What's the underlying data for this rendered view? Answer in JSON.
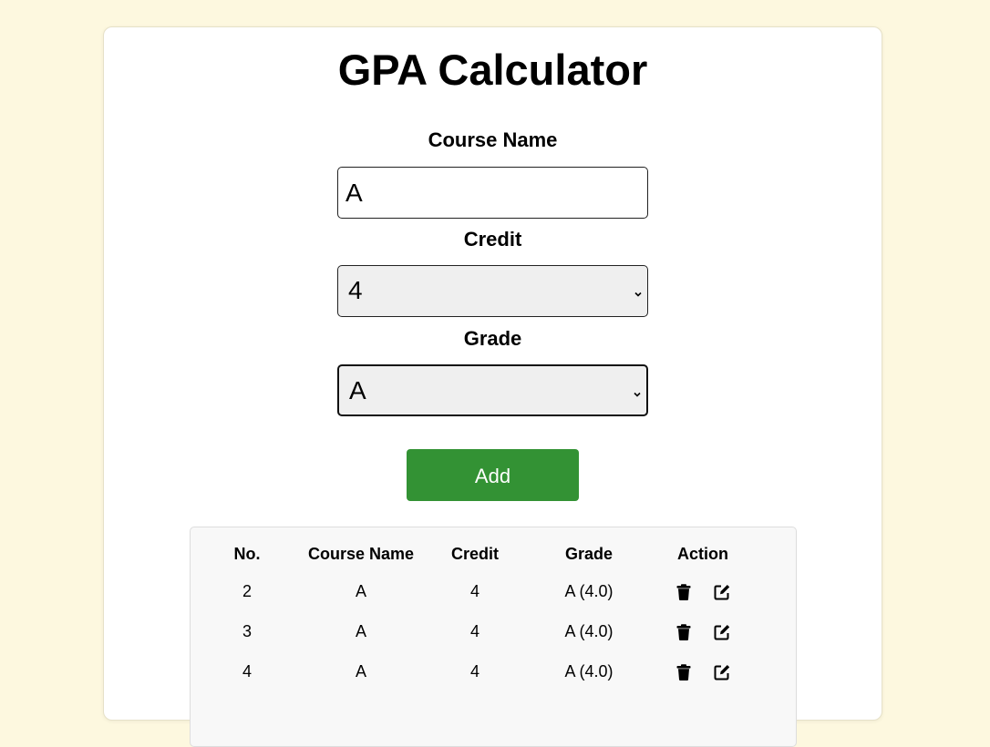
{
  "header": {
    "title": "GPA Calculator"
  },
  "form": {
    "course_name_label": "Course Name",
    "course_name_value": "A",
    "credit_label": "Credit",
    "credit_value": "4",
    "grade_label": "Grade",
    "grade_value": "A",
    "add_label": "Add"
  },
  "table": {
    "headers": {
      "no": "No.",
      "course_name": "Course Name",
      "credit": "Credit",
      "grade": "Grade",
      "action": "Action"
    },
    "rows": [
      {
        "no": "2",
        "course_name": "A",
        "credit": "4",
        "grade": "A (4.0)"
      },
      {
        "no": "3",
        "course_name": "A",
        "credit": "4",
        "grade": "A (4.0)"
      },
      {
        "no": "4",
        "course_name": "A",
        "credit": "4",
        "grade": "A (4.0)"
      }
    ],
    "row_icons": [
      "trash-icon",
      "edit-icon"
    ]
  },
  "colors": {
    "page_background": "#fdf8df",
    "add_button": "#339234",
    "table_background": "#f8f8f8"
  }
}
